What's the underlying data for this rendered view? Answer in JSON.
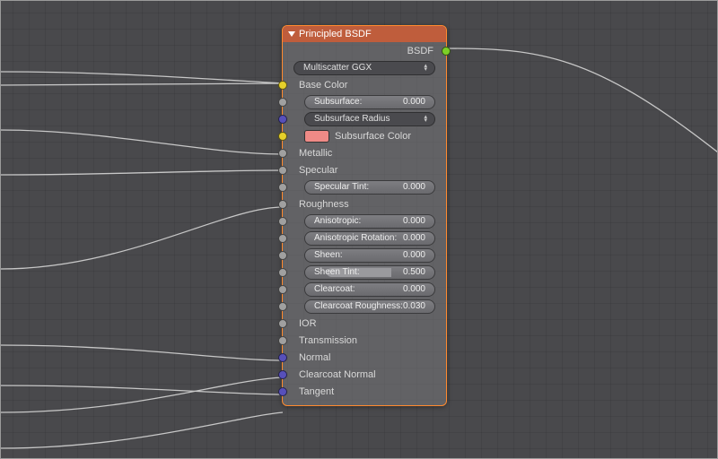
{
  "node": {
    "title": "Principled BSDF",
    "output": {
      "label": "BSDF"
    },
    "distribution": {
      "selected": "Multiscatter GGX"
    },
    "inputs": {
      "base_color": {
        "label": "Base Color"
      },
      "subsurface": {
        "label": "Subsurface:",
        "value": "0.000"
      },
      "subsurface_radius": {
        "label": "Subsurface Radius"
      },
      "subsurface_color": {
        "label": "Subsurface Color",
        "swatch": "#ef8a86"
      },
      "metallic": {
        "label": "Metallic"
      },
      "specular": {
        "label": "Specular"
      },
      "specular_tint": {
        "label": "Specular Tint:",
        "value": "0.000"
      },
      "roughness": {
        "label": "Roughness"
      },
      "anisotropic": {
        "label": "Anisotropic:",
        "value": "0.000"
      },
      "anisotropic_rotation": {
        "label": "Anisotropic Rotation:",
        "value": "0.000"
      },
      "sheen": {
        "label": "Sheen:",
        "value": "0.000"
      },
      "sheen_tint": {
        "label": "Sheen Tint:",
        "value": "0.500"
      },
      "clearcoat": {
        "label": "Clearcoat:",
        "value": "0.000"
      },
      "clearcoat_roughness": {
        "label": "Clearcoat Roughness:",
        "value": "0.030"
      },
      "ior": {
        "label": "IOR"
      },
      "transmission": {
        "label": "Transmission"
      },
      "normal": {
        "label": "Normal"
      },
      "clearcoat_normal": {
        "label": "Clearcoat Normal"
      },
      "tangent": {
        "label": "Tangent"
      }
    }
  }
}
